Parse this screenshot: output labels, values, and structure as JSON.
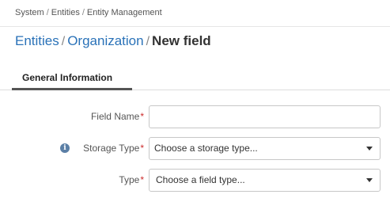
{
  "breadcrumb": {
    "items": [
      "System",
      "Entities",
      "Entity Management"
    ],
    "separator": "/"
  },
  "title": {
    "link1": "Entities",
    "link2": "Organization",
    "current": "New field",
    "separator": "/"
  },
  "tabs": [
    {
      "label": "General Information",
      "active": true
    }
  ],
  "form": {
    "field_name": {
      "label": "Field Name",
      "required_mark": "*",
      "value": ""
    },
    "storage_type": {
      "label": "Storage Type",
      "required_mark": "*",
      "selected": "Choose a storage type...",
      "info_icon": "i"
    },
    "type": {
      "label": "Type",
      "required_mark": "*",
      "selected": "Choose a field type..."
    }
  },
  "colors": {
    "link": "#2a72b8",
    "required": "#cc2b2b",
    "info_icon": "#5b7fa6"
  }
}
